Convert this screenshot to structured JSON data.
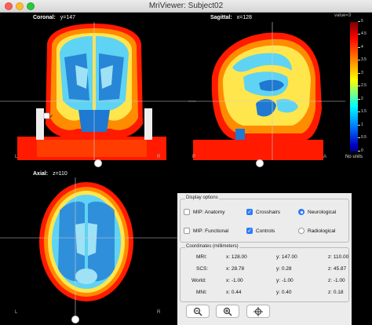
{
  "window": {
    "title": "MriViewer: Subject02"
  },
  "views": {
    "coronal": {
      "label": "Coronal:",
      "coord": "y=147",
      "orient_left": "L",
      "orient_right": "R"
    },
    "sagittal": {
      "label": "Sagittal:",
      "coord": "x=128",
      "orient_left": "P",
      "orient_right": "A"
    },
    "axial": {
      "label": "Axial:",
      "coord": "z=110",
      "orient_left": "L",
      "orient_right": "R"
    }
  },
  "colorbar": {
    "value_label": "value=3",
    "ticks": [
      "5",
      "4.5",
      "4",
      "3.5",
      "3",
      "2.5",
      "2",
      "1.5",
      "1",
      "0.5",
      "0"
    ],
    "units": "No units"
  },
  "display_options": {
    "title": "Display options",
    "mip_anatomy": {
      "label": "MIP: Anatomy",
      "checked": false
    },
    "crosshairs": {
      "label": "Crosshairs",
      "checked": true
    },
    "neurological": {
      "label": "Neurological",
      "selected": true
    },
    "mip_functional": {
      "label": "MIP: Functional",
      "checked": false
    },
    "controls": {
      "label": "Controls",
      "checked": true
    },
    "radiological": {
      "label": "Radiological",
      "selected": false
    }
  },
  "coordinates": {
    "title": "Coordinates (millimeters)",
    "rows": [
      {
        "name": "MRI:",
        "x": "x: 128.00",
        "y": "y: 147.00",
        "z": "z: 110.00"
      },
      {
        "name": "SCS:",
        "x": "x: 28.78",
        "y": "y: 0.28",
        "z": "z: 45.87"
      },
      {
        "name": "World:",
        "x": "x: -1.00",
        "y": "y: -1.00",
        "z": "z: -1.00"
      },
      {
        "name": "MNI:",
        "x": "x: 0.44",
        "y": "y: 0.40",
        "z": "z: 0.18"
      }
    ]
  },
  "toolbar": {
    "zoom_out": "zoom-out-icon",
    "zoom_in": "zoom-in-icon",
    "center": "center-crosshair-icon"
  },
  "colors": {
    "red": "#ff1a00",
    "orange": "#ff8c00",
    "yellow": "#ffe64d",
    "cyan": "#5fd3f3",
    "blue": "#1f78d1",
    "light_blue": "#9fe1f5"
  }
}
